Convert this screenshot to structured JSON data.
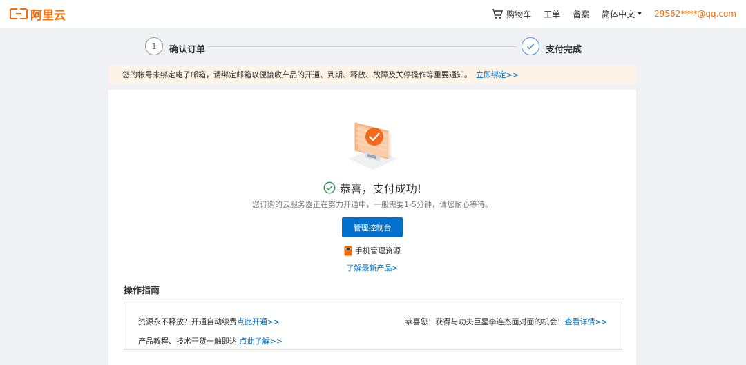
{
  "header": {
    "logo_text": "阿里云",
    "cart_label": "购物车",
    "ticket_label": "工单",
    "record_label": "备案",
    "language_label": "简体中文",
    "user_email": "29562****@qq.com"
  },
  "steps": {
    "step1_number": "1",
    "step1_label": "确认订单",
    "step2_label": "支付完成"
  },
  "notice": {
    "text": "您的帐号未绑定电子邮箱，请绑定邮箱以便接收产品的开通、到期、释放、故障及关停操作等重要通知。",
    "link": "立即绑定>>"
  },
  "result": {
    "title": "恭喜，支付成功!",
    "description": "您订购的云服务器正在努力开通中，一般需要1-5分钟，请您耐心等待。",
    "console_button": "管理控制台",
    "mobile_label": "手机管理资源",
    "learn_link": "了解最新产品>"
  },
  "guide": {
    "title": "操作指南",
    "item1_text": "资源永不释放？开通自动续费",
    "item1_link": "点此开通>>",
    "item2_text": "恭喜您！获得与功夫巨星李连杰面对面的机会！",
    "item2_link": "查看详情>>",
    "item3_text": "产品教程、技术干货一触即达 ",
    "item3_link": "点此了解>>"
  },
  "colors": {
    "brand": "#ff6a00",
    "primary": "#0070cc",
    "success": "#3a9b5c",
    "notice_bg": "#fdf4e7"
  }
}
